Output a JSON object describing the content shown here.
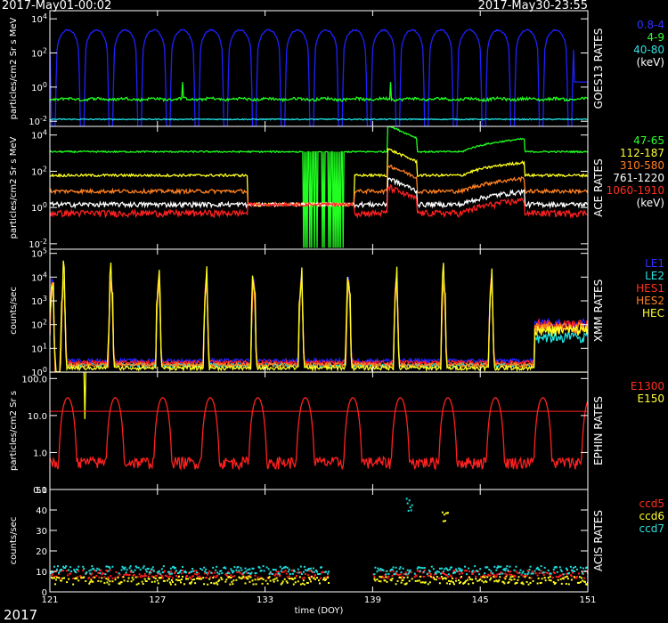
{
  "header": {
    "start": "2017-May01-00:02",
    "end": "2017-May30-23:55"
  },
  "footer": {
    "year": "2017",
    "xlabel": "time (DOY)"
  },
  "x_ticks": [
    "121",
    "127",
    "133",
    "139",
    "145",
    "151"
  ],
  "x_range": [
    121,
    151
  ],
  "chart_data": [
    {
      "type": "line",
      "title": "GOES13 RATES",
      "ylabel": "particles/cm2 Sr s MeV",
      "yscale": "log",
      "ylim": [
        0.005,
        30000
      ],
      "y_ticks": [
        "10^-2",
        "10^0",
        "10^2",
        "10^4"
      ],
      "legend": [
        {
          "label": "0.8-4",
          "color": "#3030ff"
        },
        {
          "label": "4-9",
          "color": "#30ff30"
        },
        {
          "label": "40-80",
          "color": "#30e0e0"
        },
        {
          "label": "(keV)",
          "color": "#ffffff"
        }
      ],
      "series": [
        {
          "color": "#2020ff",
          "base": 1000,
          "daily_amp": 1.2,
          "noise": 0.2
        },
        {
          "color": "#20ff20",
          "base": 0.2,
          "daily_amp": 0.1,
          "noise": 0.35
        },
        {
          "color": "#20e0e0",
          "base": 0.013,
          "daily_amp": 0.0,
          "noise": 0.15
        }
      ]
    },
    {
      "type": "line",
      "title": "ACE RATES",
      "ylabel": "particles/cm2 Sr s MeV",
      "yscale": "log",
      "ylim": [
        0.005,
        30000
      ],
      "y_ticks": [
        "10^-2",
        "10^0",
        "10^2",
        "10^4"
      ],
      "legend": [
        {
          "label": "47-65",
          "color": "#30ff30"
        },
        {
          "label": "112-187",
          "color": "#ffff30"
        },
        {
          "label": "310-580",
          "color": "#ff8020"
        },
        {
          "label": "761-1220",
          "color": "#ffffff"
        },
        {
          "label": "1060-1910",
          "color": "#ff3020"
        },
        {
          "label": "(keV)",
          "color": "#ffffff"
        }
      ],
      "series": [
        {
          "color": "#20ff20",
          "base": 1200,
          "noise": 0.05
        },
        {
          "color": "#ffff20",
          "base": 60,
          "noise": 0.08
        },
        {
          "color": "#ff8020",
          "base": 8,
          "noise": 0.12
        },
        {
          "color": "#ffffff",
          "base": 1.5,
          "noise": 0.15
        },
        {
          "color": "#ff2020",
          "base": 0.5,
          "noise": 0.2
        }
      ]
    },
    {
      "type": "line",
      "title": "XMM RATES",
      "ylabel": "counts/sec",
      "yscale": "log",
      "ylim": [
        1,
        150000
      ],
      "y_ticks": [
        "10^0",
        "10^1",
        "10^2",
        "10^3",
        "10^4",
        "10^5"
      ],
      "legend": [
        {
          "label": "LE1",
          "color": "#3030ff"
        },
        {
          "label": "LE2",
          "color": "#30e0e0"
        },
        {
          "label": "HES1",
          "color": "#ff3020"
        },
        {
          "label": "HES2",
          "color": "#ff8020"
        },
        {
          "label": "HEC",
          "color": "#ffff30"
        }
      ],
      "series": [
        {
          "color": "#2020ff",
          "base": 3
        },
        {
          "color": "#20e0e0",
          "base": 2
        },
        {
          "color": "#ff2020",
          "base": 2.5
        },
        {
          "color": "#ff8020",
          "base": 2
        },
        {
          "color": "#ffff20",
          "base": 1.5
        }
      ]
    },
    {
      "type": "line",
      "title": "EPHIN RATES",
      "ylabel": "particles/cm2 Sr s",
      "yscale": "log",
      "ylim": [
        0.1,
        150
      ],
      "y_ticks": [
        "0.1",
        "1.0",
        "10.0",
        "100.0"
      ],
      "threshold": 13,
      "legend": [
        {
          "label": "E1300",
          "color": "#ff3020"
        },
        {
          "label": "E150",
          "color": "#ffff30"
        }
      ],
      "series": [
        {
          "color": "#ff2020",
          "base": 0.3
        },
        {
          "color": "#ffff20",
          "base": 200
        }
      ]
    },
    {
      "type": "scatter",
      "title": "ACIS RATES",
      "ylabel": "counts/sec",
      "yscale": "linear",
      "ylim": [
        0,
        50
      ],
      "y_ticks": [
        "0",
        "10",
        "20",
        "30",
        "40",
        "50"
      ],
      "legend": [
        {
          "label": "ccd5",
          "color": "#ff3020"
        },
        {
          "label": "ccd6",
          "color": "#ffff30"
        },
        {
          "label": "ccd7",
          "color": "#30e0e0"
        }
      ],
      "series": [
        {
          "color": "#ff2020",
          "base": 9
        },
        {
          "color": "#ffff20",
          "base": 6
        },
        {
          "color": "#20e0e0",
          "base": 11
        }
      ]
    }
  ]
}
